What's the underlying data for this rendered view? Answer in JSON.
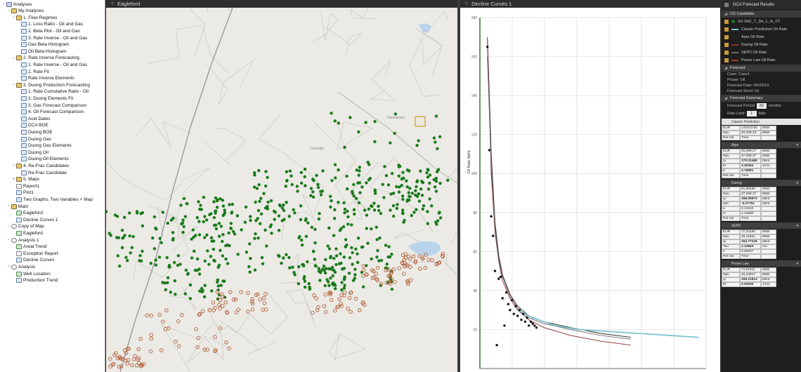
{
  "tree": {
    "items": [
      {
        "label": "Analyses",
        "level": 0,
        "icon": "root-icon",
        "expand": "−"
      },
      {
        "label": "My Analyses",
        "level": 1,
        "icon": "folder-icon",
        "expand": "−"
      },
      {
        "label": "1. Flow Regimes",
        "level": 2,
        "icon": "folder-icon",
        "expand": "−"
      },
      {
        "label": "1. Loss Ratio - Oil and Gas",
        "level": 3,
        "icon": "chart-icon",
        "expand": ""
      },
      {
        "label": "2. Beta Plot - Oil and Gas",
        "level": 3,
        "icon": "chart-icon",
        "expand": ""
      },
      {
        "label": "3. Rate Inverse - Oil and Gas",
        "level": 3,
        "icon": "chart-icon",
        "expand": ""
      },
      {
        "label": "Gas Beta Histogram",
        "level": 3,
        "icon": "chart-icon",
        "expand": ""
      },
      {
        "label": "Oil Beta Histogram",
        "level": 3,
        "icon": "chart-icon",
        "expand": ""
      },
      {
        "label": "2. Rate Inverse Forecasting",
        "level": 2,
        "icon": "folder-icon",
        "expand": "−"
      },
      {
        "label": "1. Rate Inverse - Oil and Gas",
        "level": 3,
        "icon": "chart-icon",
        "expand": ""
      },
      {
        "label": "2. Rate Fit",
        "level": 3,
        "icon": "chart-icon",
        "expand": ""
      },
      {
        "label": "Rate Inverse Elements",
        "level": 3,
        "icon": "chart-icon",
        "expand": ""
      },
      {
        "label": "3. Duong Production Forecasting",
        "level": 2,
        "icon": "folder-icon",
        "expand": "−"
      },
      {
        "label": "1. Rate Cumulative Ratio - Oil",
        "level": 3,
        "icon": "chart-icon",
        "expand": ""
      },
      {
        "label": "2. Duong Elements Fit",
        "level": 3,
        "icon": "chart-icon",
        "expand": ""
      },
      {
        "label": "3. Gas Forecast Comparison",
        "level": 3,
        "icon": "chart-icon",
        "expand": ""
      },
      {
        "label": "4. Oil Forecast Comparison",
        "level": 3,
        "icon": "chart-icon",
        "expand": ""
      },
      {
        "label": "Acid Dates",
        "level": 3,
        "icon": "chart-icon",
        "expand": ""
      },
      {
        "label": "DCA BOE",
        "level": 3,
        "icon": "chart-icon",
        "expand": ""
      },
      {
        "label": "Duong BOE",
        "level": 3,
        "icon": "chart-icon",
        "expand": ""
      },
      {
        "label": "Duong Gas",
        "level": 3,
        "icon": "chart-icon",
        "expand": ""
      },
      {
        "label": "Duong Gas Elements",
        "level": 3,
        "icon": "chart-icon",
        "expand": ""
      },
      {
        "label": "Duong Oil",
        "level": 3,
        "icon": "chart-icon",
        "expand": ""
      },
      {
        "label": "Duong Oil Elements",
        "level": 3,
        "icon": "chart-icon",
        "expand": ""
      },
      {
        "label": "4. Re-Frac Candidates",
        "level": 2,
        "icon": "folder-icon",
        "expand": "−"
      },
      {
        "label": "Re-Frac Candidate",
        "level": 3,
        "icon": "chart-icon",
        "expand": ""
      },
      {
        "label": "5. Maps",
        "level": 2,
        "icon": "folder-icon",
        "expand": "+"
      },
      {
        "label": "Report1",
        "level": 2,
        "icon": "report-icon",
        "expand": ""
      },
      {
        "label": "Plot1",
        "level": 2,
        "icon": "chart-icon",
        "expand": ""
      },
      {
        "label": "Two Graphs, Two Variables + Map",
        "level": 2,
        "icon": "chart-icon",
        "expand": ""
      },
      {
        "label": "Main",
        "level": 1,
        "icon": "folder-icon",
        "expand": "−"
      },
      {
        "label": "Eagleford",
        "level": 2,
        "icon": "map-icon",
        "expand": ""
      },
      {
        "label": "Decline Curves 1",
        "level": 2,
        "icon": "chart-icon",
        "expand": ""
      },
      {
        "label": "Copy of Map",
        "level": 1,
        "icon": "analysis-icon",
        "expand": "−"
      },
      {
        "label": "Eagleford",
        "level": 2,
        "icon": "map-icon",
        "expand": ""
      },
      {
        "label": "Analysis 1",
        "level": 1,
        "icon": "analysis-icon",
        "expand": "−"
      },
      {
        "label": "Areal Trend",
        "level": 2,
        "icon": "map-icon",
        "expand": ""
      },
      {
        "label": "Exception Report",
        "level": 2,
        "icon": "report-icon",
        "expand": ""
      },
      {
        "label": "Decline Curves",
        "level": 2,
        "icon": "chart-icon",
        "expand": ""
      },
      {
        "label": "Analysis",
        "level": 1,
        "icon": "analysis-icon",
        "expand": "−"
      },
      {
        "label": "Well Location",
        "level": 2,
        "icon": "map-icon",
        "expand": ""
      },
      {
        "label": "Production Trend",
        "level": 2,
        "icon": "chart-icon",
        "expand": ""
      }
    ]
  },
  "map": {
    "title": "Eagleford",
    "green_color": "#1a7a1a",
    "brown_color": "#b5603a",
    "places": [
      "Pleasanton",
      "Charlotte"
    ]
  },
  "decline": {
    "title": "Decline Curves 1",
    "chart_data": {
      "type": "scatter",
      "title": "",
      "xlabel": "",
      "ylabel": "Oil Rate bbl/d",
      "ylim": [
        0,
        180
      ],
      "yticks": [
        20,
        40,
        60,
        80,
        100,
        120,
        140,
        160,
        180
      ],
      "x_unit": "month index",
      "x_range": [
        0,
        60
      ],
      "points": [
        {
          "x": 2,
          "y": 165
        },
        {
          "x": 2.5,
          "y": 112
        },
        {
          "x": 3,
          "y": 78
        },
        {
          "x": 3.5,
          "y": 68
        },
        {
          "x": 4,
          "y": 50
        },
        {
          "x": 5,
          "y": 46
        },
        {
          "x": 5.5,
          "y": 47
        },
        {
          "x": 4.5,
          "y": 12
        },
        {
          "x": 6,
          "y": 36
        },
        {
          "x": 6.5,
          "y": 22
        },
        {
          "x": 7,
          "y": 39
        },
        {
          "x": 7.5,
          "y": 33
        },
        {
          "x": 8,
          "y": 30
        },
        {
          "x": 8.5,
          "y": 35
        },
        {
          "x": 9,
          "y": 28
        },
        {
          "x": 9.5,
          "y": 32
        },
        {
          "x": 10,
          "y": 27
        },
        {
          "x": 10.5,
          "y": 30
        },
        {
          "x": 11,
          "y": 25
        },
        {
          "x": 11.5,
          "y": 28
        },
        {
          "x": 12,
          "y": 24
        },
        {
          "x": 12.5,
          "y": 26
        },
        {
          "x": 13,
          "y": 22
        },
        {
          "x": 13.5,
          "y": 24
        },
        {
          "x": 14,
          "y": 23
        },
        {
          "x": 14.5,
          "y": 22
        },
        {
          "x": 15,
          "y": 21
        }
      ],
      "series": [
        {
          "name": "Arps Oil Rate",
          "color": "#222222",
          "values": [
            [
              2,
              170
            ],
            [
              3,
              110
            ],
            [
              4,
              75
            ],
            [
              5,
              58
            ],
            [
              6,
              48
            ],
            [
              8,
              38
            ],
            [
              10,
              32
            ],
            [
              13,
              27
            ],
            [
              17,
              24
            ],
            [
              24,
              21
            ],
            [
              32,
              18
            ],
            [
              40,
              16
            ]
          ]
        },
        {
          "name": "Duong Oil Rate",
          "color": "#8a2a2a",
          "values": [
            [
              2,
              168
            ],
            [
              3,
              100
            ],
            [
              4,
              70
            ],
            [
              5,
              55
            ],
            [
              6,
              45
            ],
            [
              8,
              36
            ],
            [
              10,
              30
            ],
            [
              13,
              25
            ],
            [
              17,
              21
            ],
            [
              24,
              17
            ],
            [
              32,
              14
            ],
            [
              40,
              12
            ]
          ]
        },
        {
          "name": "SEPD Oil Rate",
          "color": "#6a6a6a",
          "values": [
            [
              2,
              160
            ],
            [
              3,
              105
            ],
            [
              4,
              72
            ],
            [
              5,
              56
            ],
            [
              6,
              47
            ],
            [
              8,
              37
            ],
            [
              10,
              31
            ],
            [
              13,
              26
            ],
            [
              17,
              23
            ],
            [
              24,
              20
            ],
            [
              32,
              17
            ],
            [
              40,
              15
            ]
          ]
        },
        {
          "name": "Power Law Oil Rate",
          "color": "#7fc4d2",
          "values": [
            [
              10,
              30
            ],
            [
              14,
              26
            ],
            [
              20,
              22
            ],
            [
              26,
              20
            ],
            [
              34,
              19
            ],
            [
              42,
              18
            ],
            [
              50,
              17
            ],
            [
              58,
              16
            ]
          ]
        }
      ]
    }
  },
  "results": {
    "title": "DCA Forecast Results",
    "sections": {
      "candidate": "CD Candidate",
      "forecast": "Forecast",
      "summary": "Forecast Summary"
    },
    "legend": [
      {
        "label": "SV-1NC_T_3H_1_%_FT",
        "color": "#1a7a1a",
        "kind": "dot"
      },
      {
        "label": "Classic Prediction Oil Rate",
        "color": "#7fc4d2",
        "kind": "line"
      },
      {
        "label": "Arps Oil Rate",
        "color": "#222222",
        "kind": "line"
      },
      {
        "label": "Duong Oil Rate",
        "color": "#8a2a2a",
        "kind": "line"
      },
      {
        "label": "SEPD Oil Rate",
        "color": "#6a6a6a",
        "kind": "line"
      },
      {
        "label": "Power Law Oil Rate",
        "color": "#a03a2a",
        "kind": "line"
      }
    ],
    "forecast_lines": [
      "Case: Case1",
      "Phase: Oil",
      "Forecast Date: 4/6/2014",
      "Forecast Seed: Dy"
    ],
    "forecast_period_label": "Forecast Period",
    "forecast_period_value": "60",
    "forecast_period_unit": "months",
    "rate_limit_label": "Rate Limit",
    "rate_limit_value": "1",
    "rate_limit_unit": "bbls",
    "candidates": [
      "Classic Prediction",
      "Arps",
      "Duong",
      "SEPD",
      "Power Law"
    ],
    "table_rows": [
      [
        "EUR",
        "143243.64",
        "Mbbl"
      ],
      [
        "Npu",
        "93,209,13",
        "Mbbl"
      ],
      [
        "Rel.Var",
        "Time",
        ""
      ],
      [
        "EUR",
        "91,089.27",
        "Mbbl"
      ],
      [
        "Npu",
        "27,098.37",
        "Mbbl"
      ],
      [
        "qi",
        "170.01485",
        "bbl/d"
      ],
      [
        "Di",
        "3.35254",
        "1/mo"
      ],
      [
        "b",
        "3.76891",
        ""
      ],
      [
        "Rel.Var",
        "Time",
        ""
      ],
      [
        "EUR",
        "81,69492",
        "Mbbl"
      ],
      [
        "Npu",
        "27,098.37",
        "Mbbl"
      ],
      [
        "qi",
        "168.05874",
        "bbl/d"
      ],
      [
        "qinf",
        "-0.27751",
        "bbl/d"
      ],
      [
        "a",
        "0.13220",
        ""
      ],
      [
        "m",
        "1.13590",
        ""
      ],
      [
        "Rel.Var",
        "Time",
        ""
      ],
      [
        "EUR",
        "77,33180",
        "Mbbl"
      ],
      [
        "Npu",
        "26,11591",
        "Mbbl"
      ],
      [
        "qi",
        "164.77418",
        "bbl/d"
      ],
      [
        "Tau",
        "4.13843",
        "mo"
      ],
      [
        "n",
        "0.53007",
        ""
      ],
      [
        "Rel.Var",
        "Time",
        ""
      ],
      [
        "EUR",
        "73,91911",
        "Mbbl"
      ],
      [
        "Npu",
        "26,44917",
        "Mbbl"
      ],
      [
        "qi",
        "165.21914",
        "bbl/d"
      ],
      [
        "Di",
        "0.00000",
        "1/mo"
      ]
    ]
  }
}
